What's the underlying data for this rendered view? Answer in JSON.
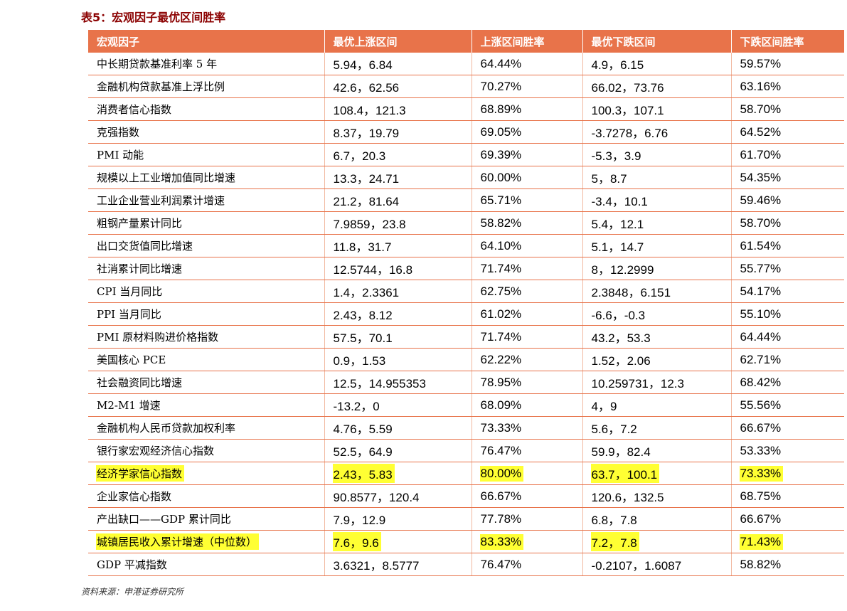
{
  "caption": "表5：宏观因子最优区间胜率",
  "source": "资料来源：申港证券研究所",
  "colors": {
    "header_bg": "#e8734a",
    "highlight": "#ffff33",
    "caption": "#8b0000"
  },
  "table": {
    "headers": [
      "宏观因子",
      "最优上涨区间",
      "上涨区间胜率",
      "最优下跌区间",
      "下跌区间胜率"
    ],
    "rows": [
      {
        "factor": "中长期贷款基准利率 5 年",
        "up_range": "5.94，6.84",
        "up_win": "64.44%",
        "down_range": "4.9，6.15",
        "down_win": "59.57%",
        "highlight": false
      },
      {
        "factor": "金融机构贷款基准上浮比例",
        "up_range": "42.6，62.56",
        "up_win": "70.27%",
        "down_range": "66.02，73.76",
        "down_win": "63.16%",
        "highlight": false
      },
      {
        "factor": "消费者信心指数",
        "up_range": "108.4，121.3",
        "up_win": "68.89%",
        "down_range": "100.3，107.1",
        "down_win": "58.70%",
        "highlight": false
      },
      {
        "factor": "克强指数",
        "up_range": "8.37，19.79",
        "up_win": "69.05%",
        "down_range": "-3.7278，6.76",
        "down_win": "64.52%",
        "highlight": false
      },
      {
        "factor": "PMI 动能",
        "up_range": "6.7，20.3",
        "up_win": "69.39%",
        "down_range": "-5.3，3.9",
        "down_win": "61.70%",
        "highlight": false
      },
      {
        "factor": "规模以上工业增加值同比增速",
        "up_range": "13.3，24.71",
        "up_win": "60.00%",
        "down_range": "5，8.7",
        "down_win": "54.35%",
        "highlight": false
      },
      {
        "factor": "工业企业营业利润累计增速",
        "up_range": "21.2，81.64",
        "up_win": "65.71%",
        "down_range": "-3.4，10.1",
        "down_win": "59.46%",
        "highlight": false
      },
      {
        "factor": "粗钢产量累计同比",
        "up_range": "7.9859，23.8",
        "up_win": "58.82%",
        "down_range": "5.4，12.1",
        "down_win": "58.70%",
        "highlight": false
      },
      {
        "factor": "出口交货值同比增速",
        "up_range": "11.8，31.7",
        "up_win": "64.10%",
        "down_range": "5.1，14.7",
        "down_win": "61.54%",
        "highlight": false
      },
      {
        "factor": "社消累计同比增速",
        "up_range": "12.5744，16.8",
        "up_win": "71.74%",
        "down_range": "8，12.2999",
        "down_win": "55.77%",
        "highlight": false
      },
      {
        "factor": "CPI 当月同比",
        "up_range": "1.4，2.3361",
        "up_win": "62.75%",
        "down_range": "2.3848，6.151",
        "down_win": "54.17%",
        "highlight": false
      },
      {
        "factor": "PPI 当月同比",
        "up_range": "2.43，8.12",
        "up_win": "61.02%",
        "down_range": "-6.6，-0.3",
        "down_win": "55.10%",
        "highlight": false
      },
      {
        "factor": "PMI 原材料购进价格指数",
        "up_range": "57.5，70.1",
        "up_win": "71.74%",
        "down_range": "43.2，53.3",
        "down_win": "64.44%",
        "highlight": false
      },
      {
        "factor": "美国核心 PCE",
        "up_range": "0.9，1.53",
        "up_win": "62.22%",
        "down_range": "1.52，2.06",
        "down_win": "62.71%",
        "highlight": false
      },
      {
        "factor": "社会融资同比增速",
        "up_range": "12.5，14.955353",
        "up_win": "78.95%",
        "down_range": "10.259731，12.3",
        "down_win": "68.42%",
        "highlight": false
      },
      {
        "factor": "M2-M1 增速",
        "up_range": "-13.2，0",
        "up_win": "68.09%",
        "down_range": "4，9",
        "down_win": "55.56%",
        "highlight": false
      },
      {
        "factor": "金融机构人民币贷款加权利率",
        "up_range": "4.76，5.59",
        "up_win": "73.33%",
        "down_range": "5.6，7.2",
        "down_win": "66.67%",
        "highlight": false
      },
      {
        "factor": "银行家宏观经济信心指数",
        "up_range": "52.5，64.9",
        "up_win": "76.47%",
        "down_range": "59.9，82.4",
        "down_win": "53.33%",
        "highlight": false
      },
      {
        "factor": "经济学家信心指数",
        "up_range": "2.43，5.83",
        "up_win": "80.00%",
        "down_range": "63.7，100.1",
        "down_win": "73.33%",
        "highlight": true
      },
      {
        "factor": "企业家信心指数",
        "up_range": "90.8577，120.4",
        "up_win": "66.67%",
        "down_range": "120.6，132.5",
        "down_win": "68.75%",
        "highlight": false
      },
      {
        "factor": "产出缺口——GDP 累计同比",
        "up_range": "7.9，12.9",
        "up_win": "77.78%",
        "down_range": "6.8，7.8",
        "down_win": "66.67%",
        "highlight": false
      },
      {
        "factor": "城镇居民收入累计增速（中位数）",
        "up_range": "7.6，9.6",
        "up_win": "83.33%",
        "down_range": "7.2，7.8",
        "down_win": "71.43%",
        "highlight": true
      },
      {
        "factor": "GDP 平减指数",
        "up_range": "3.6321，8.5777",
        "up_win": "76.47%",
        "down_range": "-0.2107，1.6087",
        "down_win": "58.82%",
        "highlight": false
      }
    ]
  }
}
